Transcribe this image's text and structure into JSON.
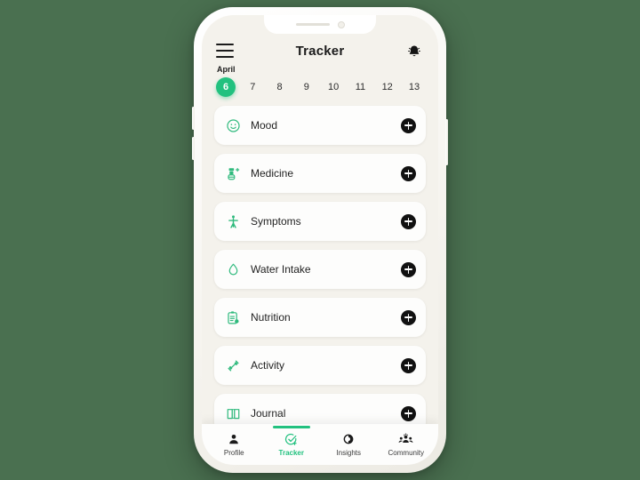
{
  "header": {
    "title": "Tracker",
    "menu_icon": "hamburger-menu-icon",
    "notification_icon": "bell-icon"
  },
  "date_strip": {
    "month": "April",
    "selected_day": "6",
    "days": [
      "6",
      "7",
      "8",
      "9",
      "10",
      "11",
      "12",
      "13"
    ]
  },
  "tracker_list": {
    "add_label": "+",
    "items": [
      {
        "label": "Mood",
        "icon": "smiley-face-icon"
      },
      {
        "label": "Medicine",
        "icon": "medicine-bottle-icon"
      },
      {
        "label": "Symptoms",
        "icon": "person-body-icon"
      },
      {
        "label": "Water Intake",
        "icon": "water-drop-icon"
      },
      {
        "label": "Nutrition",
        "icon": "clipboard-nutrition-icon"
      },
      {
        "label": "Activity",
        "icon": "dumbbell-icon"
      },
      {
        "label": "Journal",
        "icon": "open-book-icon"
      }
    ]
  },
  "bottom_nav": {
    "active": "Tracker",
    "items": [
      {
        "label": "Profile",
        "icon": "person-icon"
      },
      {
        "label": "Tracker",
        "icon": "check-circle-plus-icon"
      },
      {
        "label": "Insights",
        "icon": "pie-chart-icon"
      },
      {
        "label": "Community",
        "icon": "people-group-icon"
      }
    ]
  },
  "colors": {
    "background": "#4a7050",
    "accent_green": "#22c17f",
    "card": "#fdfdfc",
    "screen_bg": "#f4f2ec",
    "add_button": "#111111"
  }
}
